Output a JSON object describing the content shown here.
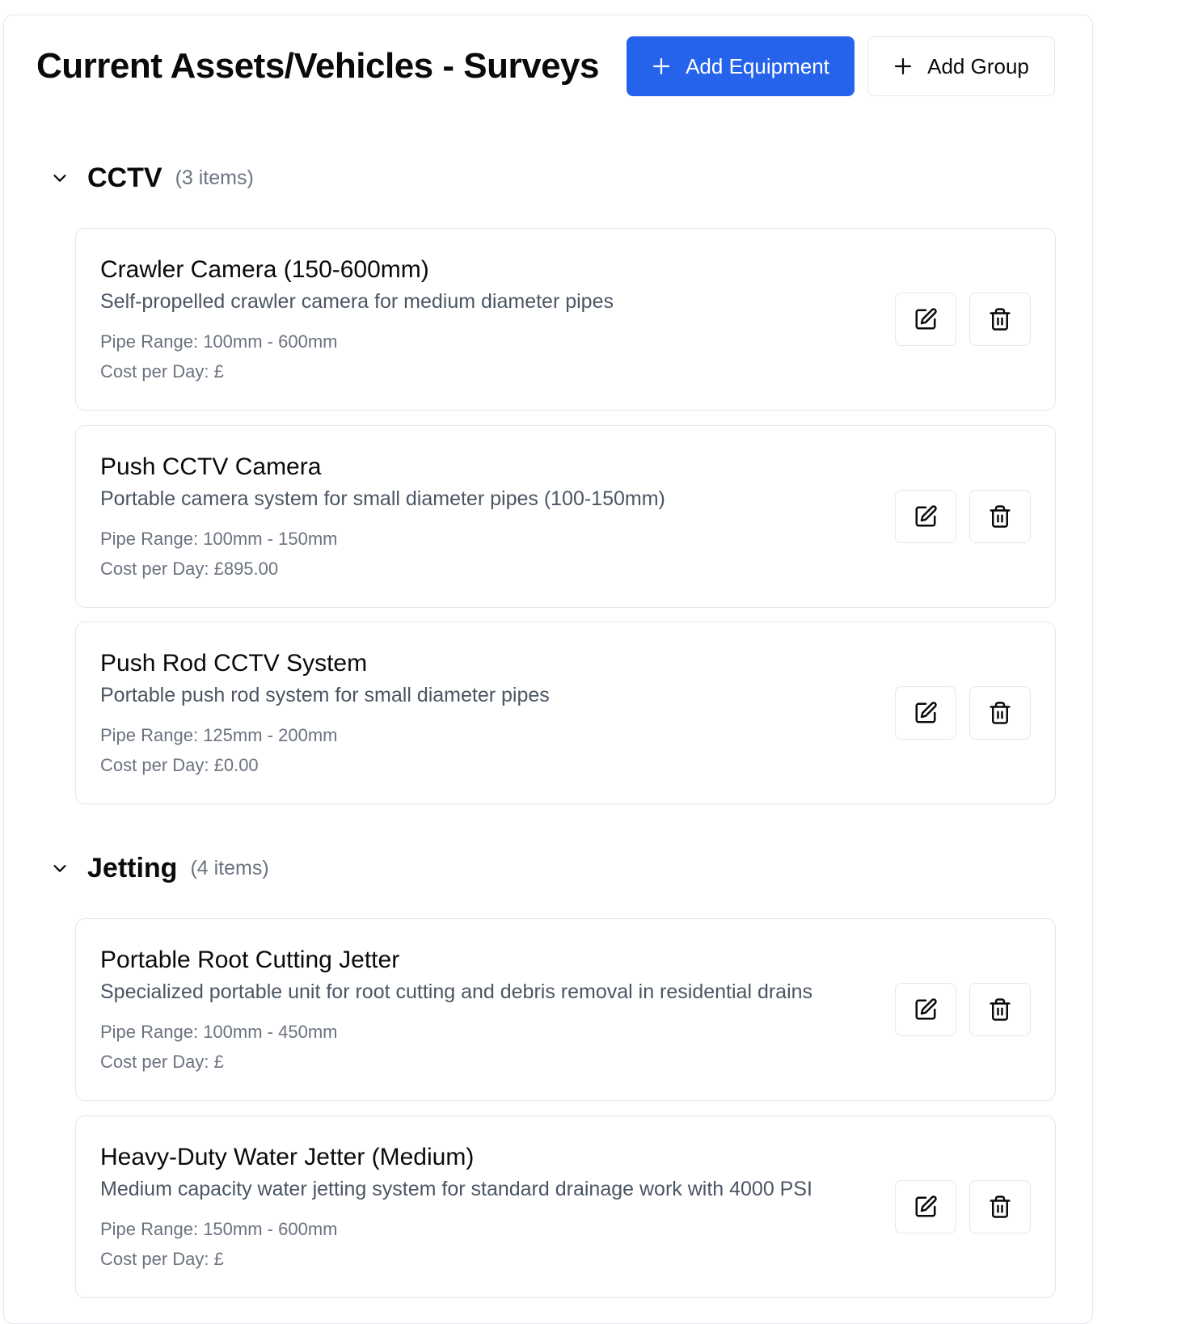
{
  "page": {
    "title": "Current Assets/Vehicles - Surveys",
    "add_equipment_label": "Add Equipment",
    "add_group_label": "Add Group"
  },
  "labels": {
    "pipe_range_prefix": "Pipe Range: ",
    "cost_prefix": "Cost per Day: "
  },
  "colors": {
    "primary": "#2563eb",
    "border": "#e5e7eb",
    "muted_text": "#6b7280",
    "description_text": "#4b5563"
  },
  "groups": [
    {
      "name": "CCTV",
      "count": "(3 items)",
      "items": [
        {
          "name": "Crawler Camera (150-600mm)",
          "description": "Self-propelled crawler camera for medium diameter pipes",
          "pipe_range": "Pipe Range: 100mm - 600mm",
          "cost": "Cost per Day: £"
        },
        {
          "name": "Push CCTV Camera",
          "description": "Portable camera system for small diameter pipes (100-150mm)",
          "pipe_range": "Pipe Range: 100mm - 150mm",
          "cost": "Cost per Day: £895.00"
        },
        {
          "name": "Push Rod CCTV System",
          "description": "Portable push rod system for small diameter pipes",
          "pipe_range": "Pipe Range: 125mm - 200mm",
          "cost": "Cost per Day: £0.00"
        }
      ]
    },
    {
      "name": "Jetting",
      "count": "(4 items)",
      "items": [
        {
          "name": "Portable Root Cutting Jetter",
          "description": "Specialized portable unit for root cutting and debris removal in residential drains",
          "pipe_range": "Pipe Range: 100mm - 450mm",
          "cost": "Cost per Day: £"
        },
        {
          "name": "Heavy-Duty Water Jetter (Medium)",
          "description": "Medium capacity water jetting system for standard drainage work with 4000 PSI",
          "pipe_range": "Pipe Range: 150mm - 600mm",
          "cost": "Cost per Day: £"
        }
      ]
    }
  ],
  "icons": {
    "add": "plus-icon",
    "collapse": "chevron-down-icon",
    "edit": "edit-icon",
    "delete": "trash-icon"
  }
}
